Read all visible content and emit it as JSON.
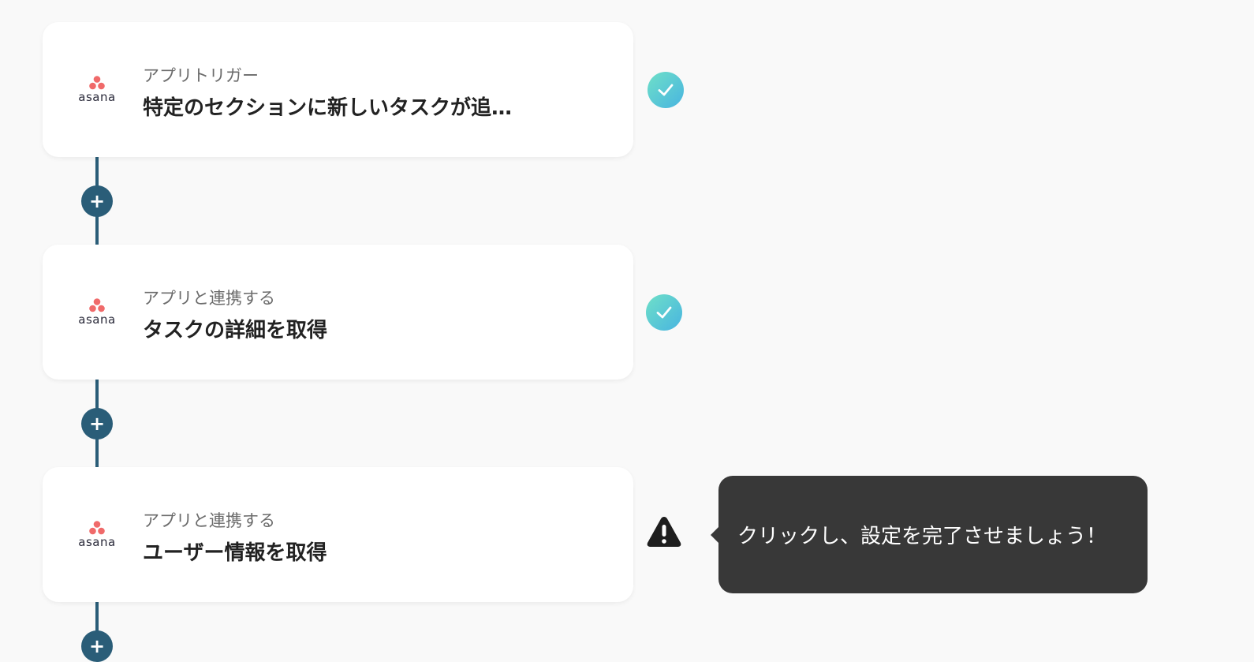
{
  "steps": [
    {
      "app": "asana",
      "subtitle": "アプリトリガー",
      "title": "特定のセクションに新しいタスクが追…",
      "status": "complete"
    },
    {
      "app": "asana",
      "subtitle": "アプリと連携する",
      "title": "タスクの詳細を取得",
      "status": "complete"
    },
    {
      "app": "asana",
      "subtitle": "アプリと連携する",
      "title": "ユーザー情報を取得",
      "status": "warning"
    }
  ],
  "add_button": {
    "symbol": "+"
  },
  "tooltip": {
    "text": "クリックし、設定を完了させましょう！"
  },
  "colors": {
    "background": "#f9f9f9",
    "connector": "#2a5d78",
    "check_gradient_start": "#6fe0c8",
    "check_gradient_end": "#48b4e0",
    "asana_dot": "#f06a6a",
    "tooltip_bg": "#383838"
  },
  "icons": {
    "app_logo": "asana-logo",
    "complete": "check-icon",
    "warning": "warning-icon",
    "add": "plus-icon"
  }
}
